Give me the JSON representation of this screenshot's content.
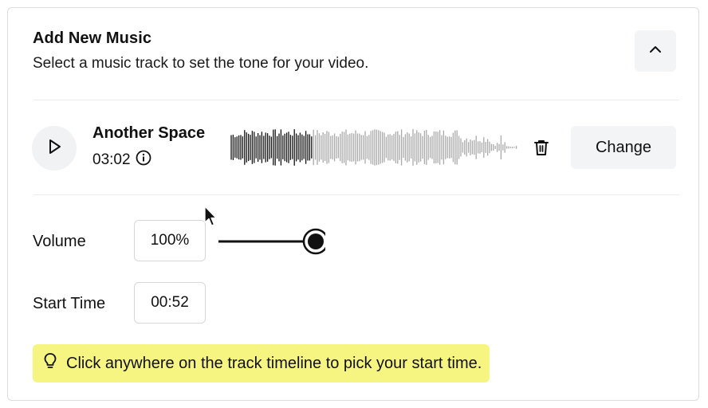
{
  "header": {
    "title": "Add New Music",
    "subtitle": "Select a music track to set the tone for your video.",
    "collapse_icon": "chevron-up-icon"
  },
  "track": {
    "name": "Another Space",
    "duration": "03:02",
    "info_icon": "info-icon",
    "play_icon": "play-icon",
    "delete_icon": "trash-icon",
    "change_label": "Change"
  },
  "settings": {
    "volume_label": "Volume",
    "volume_value": "100%",
    "volume_level": 1.0,
    "start_time_label": "Start Time",
    "start_time_value": "00:52"
  },
  "tip": {
    "icon": "lightbulb-icon",
    "text": "Click anywhere on the track timeline to pick your start time."
  },
  "colors": {
    "tip_background": "#f7f582",
    "button_background": "#f3f4f6",
    "waveform_played": "#111111",
    "waveform_unplayed": "#a9a9a9"
  }
}
